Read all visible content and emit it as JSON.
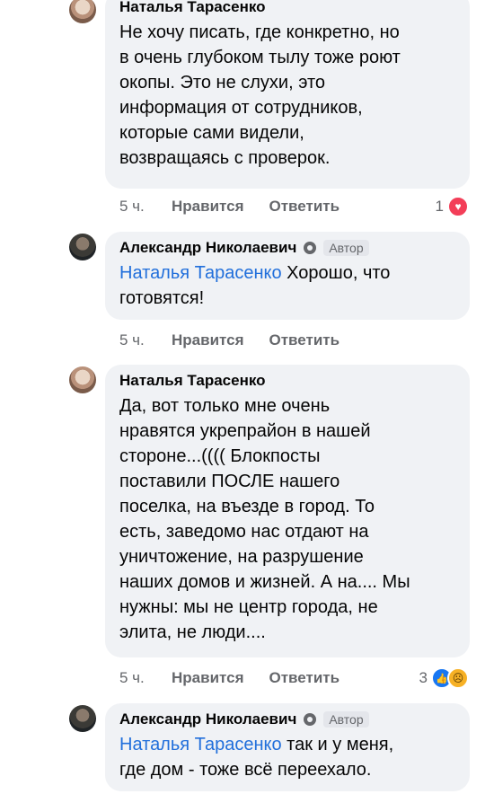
{
  "comments": [
    {
      "author": "Наталья Тарасенко",
      "avatar_icon": "profile-photo-woman",
      "lines": [
        "Не хочу писать, где конкретно, но",
        "в очень глубоком тылу тоже роют",
        "окопы. Это не слухи, это",
        "информация от сотрудников,",
        "которые сами видели,",
        "возвращаясь с проверок."
      ],
      "time": "5 ч.",
      "like": "Нравится",
      "reply": "Ответить",
      "reaction_count": "1",
      "reactions": [
        "heart-icon"
      ]
    },
    {
      "author": "Александр Николаевич",
      "avatar_icon": "profile-photo-man",
      "badge": "Автор",
      "mention": "Наталья Тарасенко",
      "lines": [
        " Хорошо, что",
        "готовятся!"
      ],
      "time": "5 ч.",
      "like": "Нравится",
      "reply": "Ответить"
    },
    {
      "author": "Наталья Тарасенко",
      "avatar_icon": "profile-photo-woman",
      "lines": [
        "Да, вот только мне очень",
        "нравятся укрепрайон в нашей",
        "стороне...(((( Блокпосты",
        "поставили ПОСЛЕ нашего",
        "поселка, на въезде в город. То",
        "есть, заведомо нас отдают на",
        "уничтожение, на разрушение",
        "наших домов и жизней. А на.... Мы",
        "нужны: мы не центр города, не",
        "элита, не люди...."
      ],
      "time": "5 ч.",
      "like": "Нравится",
      "reply": "Ответить",
      "reaction_count": "3",
      "reactions": [
        "like-icon",
        "sad-icon"
      ]
    },
    {
      "author": "Александр Николаевич",
      "avatar_icon": "profile-photo-man",
      "badge": "Автор",
      "mention": "Наталья Тарасенко",
      "lines": [
        " так и у меня,",
        "где дом - тоже всё переехало."
      ]
    }
  ],
  "colors": {
    "bubble": "#f0f2f5",
    "mention": "#216fdb",
    "meta": "#65676b",
    "heart": "#f33e58",
    "like": "#1877f2",
    "sad": "#f7b125"
  }
}
